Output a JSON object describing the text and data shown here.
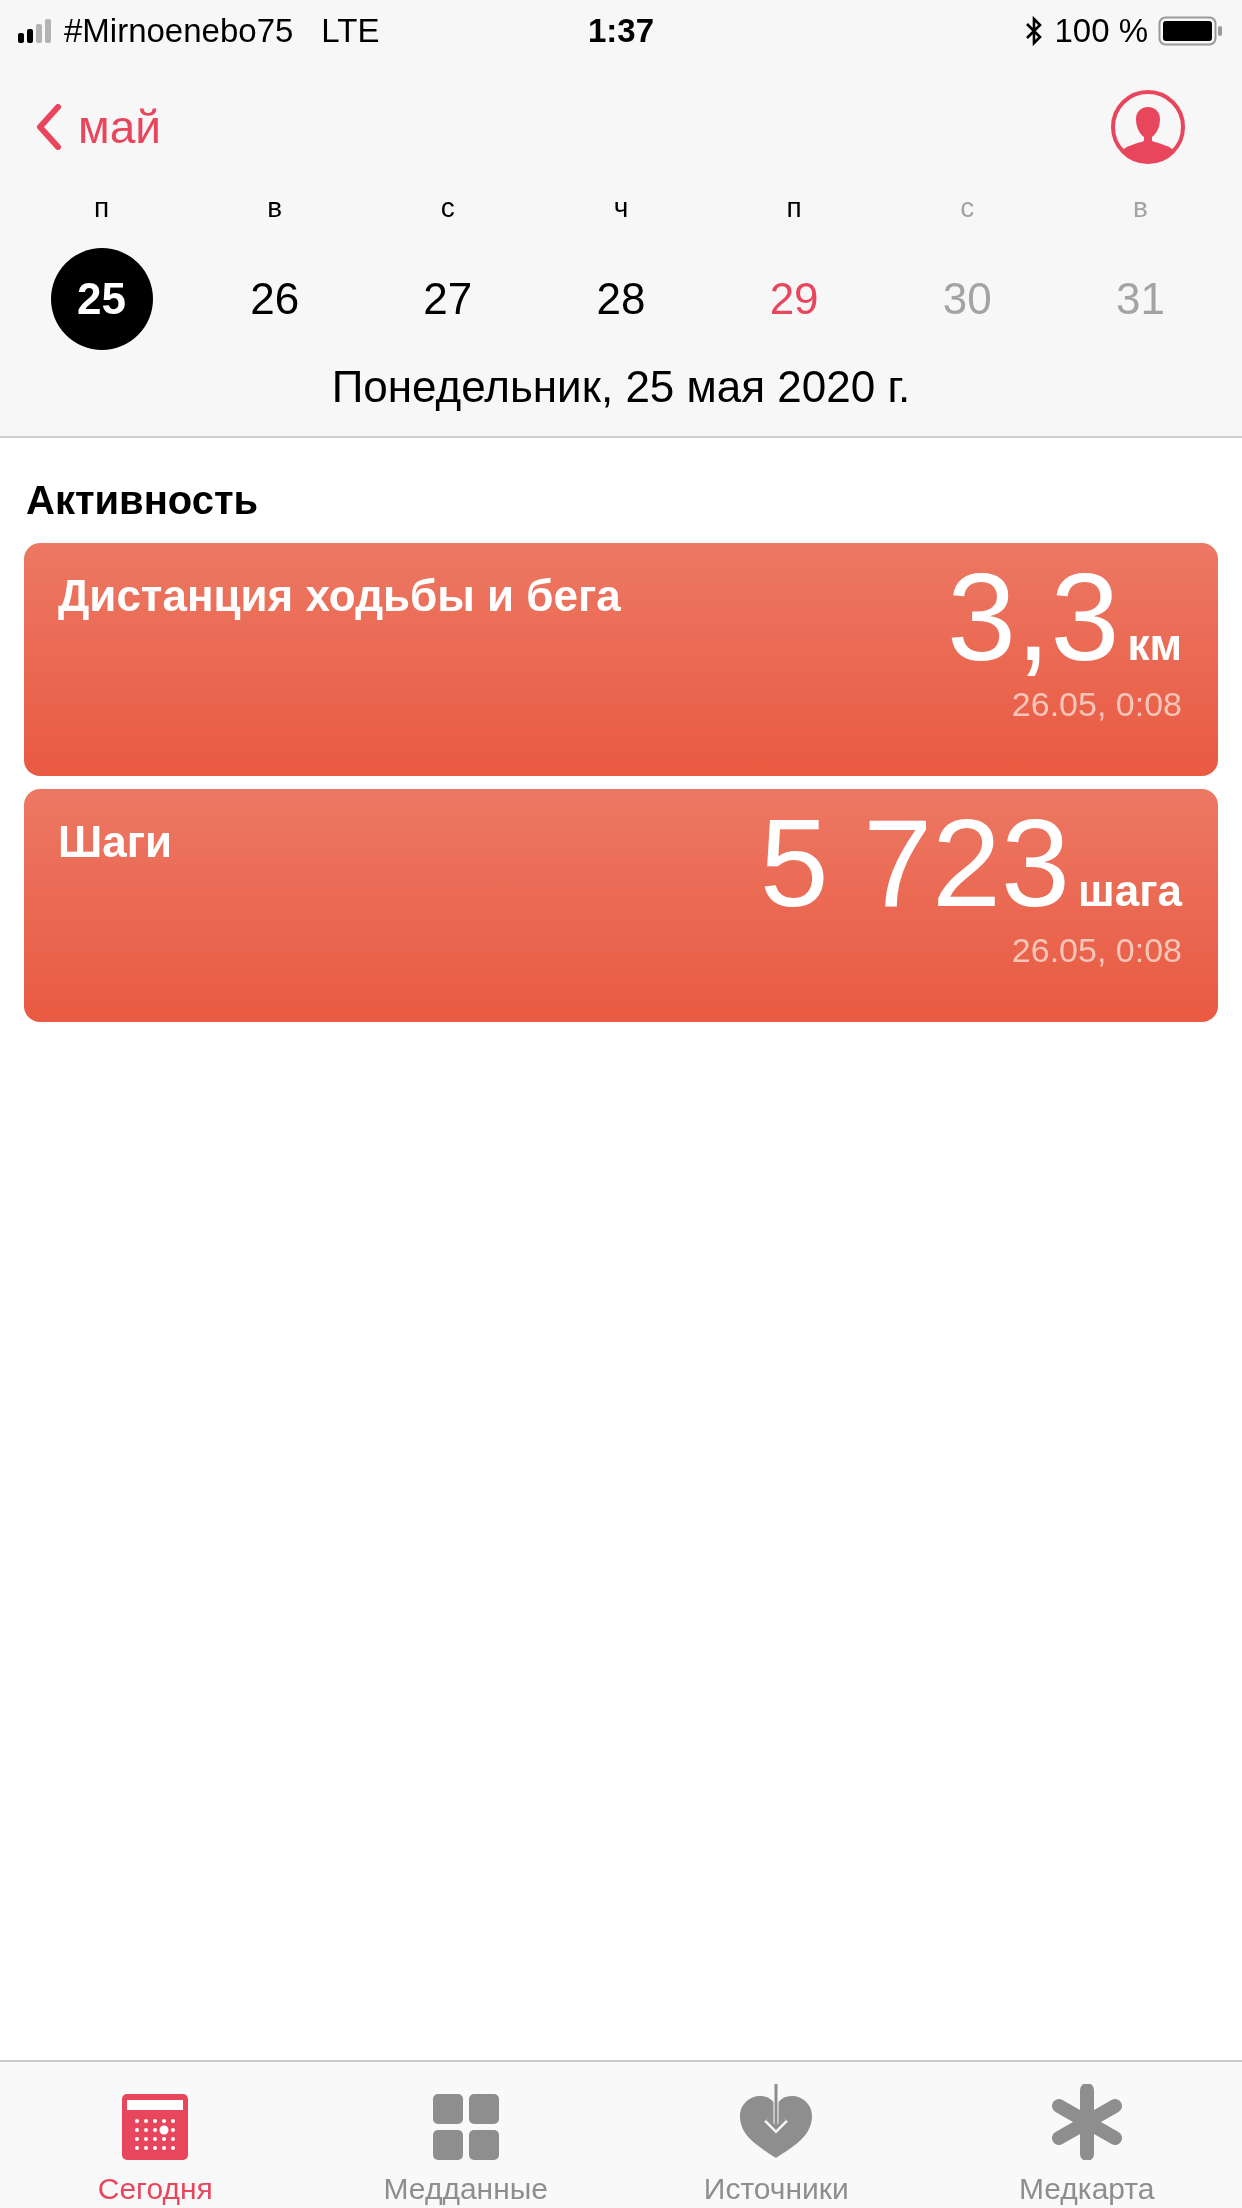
{
  "status_bar": {
    "carrier": "#Mirnoenebo75",
    "network": "LTE",
    "time": "1:37",
    "battery": "100 %"
  },
  "nav": {
    "back_label": "май"
  },
  "week": [
    {
      "weekday": "п",
      "day": "25",
      "selected": true,
      "kind": "past"
    },
    {
      "weekday": "в",
      "day": "26",
      "selected": false,
      "kind": "past"
    },
    {
      "weekday": "с",
      "day": "27",
      "selected": false,
      "kind": "past"
    },
    {
      "weekday": "ч",
      "day": "28",
      "selected": false,
      "kind": "past"
    },
    {
      "weekday": "п",
      "day": "29",
      "selected": false,
      "kind": "today"
    },
    {
      "weekday": "с",
      "day": "30",
      "selected": false,
      "kind": "future"
    },
    {
      "weekday": "в",
      "day": "31",
      "selected": false,
      "kind": "future"
    }
  ],
  "date_title": "Понедельник, 25 мая 2020 г.",
  "section_title": "Активность",
  "cards": [
    {
      "title": "Дистанция ходьбы и бега",
      "value": "3,3",
      "unit": "км",
      "time": "26.05, 0:08"
    },
    {
      "title": "Шаги",
      "value": "5 723",
      "unit": "шага",
      "time": "26.05, 0:08"
    }
  ],
  "tabs": [
    {
      "label": "Сегодня",
      "selected": true
    },
    {
      "label": "Медданные",
      "selected": false
    },
    {
      "label": "Источники",
      "selected": false
    },
    {
      "label": "Медкарта",
      "selected": false
    }
  ]
}
